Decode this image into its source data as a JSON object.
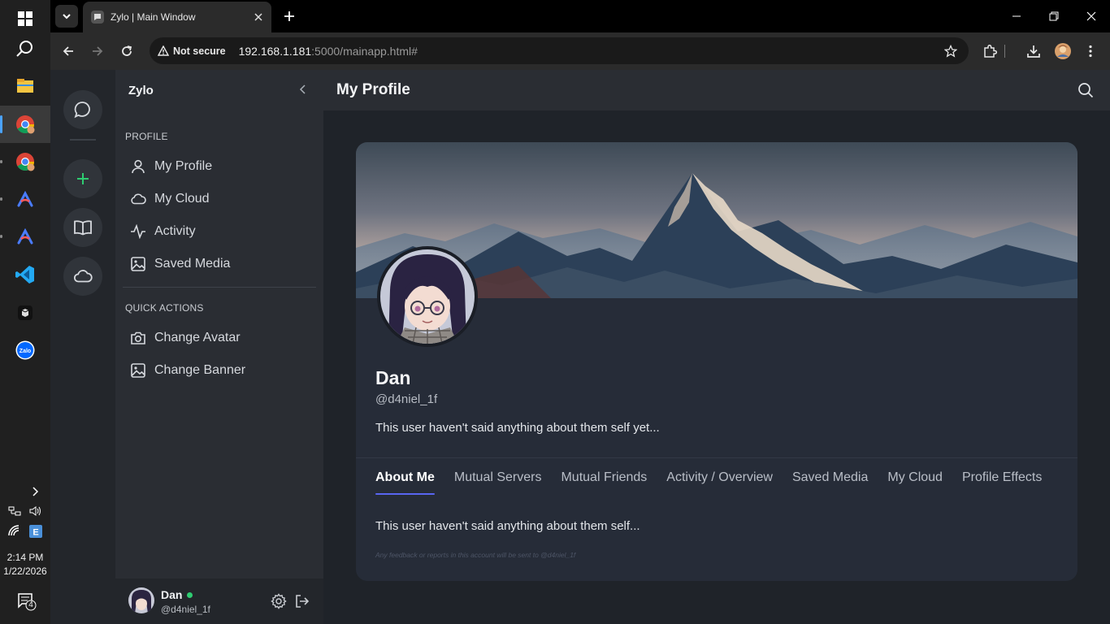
{
  "taskbar": {
    "time": "2:14 PM",
    "date": "1/22/2026",
    "notification_count": "4",
    "colors": {
      "accent": "#4aa3ff",
      "background": "#202020"
    }
  },
  "browser": {
    "tab_title": "Zylo | Main Window",
    "security_label": "Not secure",
    "url_host": "192.168.1.181",
    "url_rest": ":5000/mainapp.html#"
  },
  "app": {
    "sidebar": {
      "title": "Zylo",
      "profile_section": "PROFILE",
      "profile_items": [
        {
          "label": "My Profile",
          "icon": "user-icon"
        },
        {
          "label": "My Cloud",
          "icon": "cloud-icon"
        },
        {
          "label": "Activity",
          "icon": "activity-icon"
        },
        {
          "label": "Saved Media",
          "icon": "image-icon"
        }
      ],
      "quick_section": "QUICK ACTIONS",
      "quick_items": [
        {
          "label": "Change Avatar",
          "icon": "camera-icon"
        },
        {
          "label": "Change Banner",
          "icon": "image-icon"
        }
      ],
      "footer": {
        "name": "Dan",
        "handle": "@d4niel_1f",
        "status_color": "#2ecc71"
      }
    },
    "header": {
      "title": "My Profile"
    },
    "profile": {
      "name": "Dan",
      "handle": "@d4niel_1f",
      "bio": "This user haven't said anything about them self yet...",
      "tabs": [
        "About Me",
        "Mutual Servers",
        "Mutual Friends",
        "Activity / Overview",
        "Saved Media",
        "My Cloud",
        "Profile Effects"
      ],
      "active_tab": "About Me",
      "about_text": "This user haven't said anything about them self...",
      "fine_print": "Any feedback or reports in this account will be sent to @d4niel_1f",
      "colors": {
        "tab_accent": "#5865f2",
        "card_bg": "#262c38"
      }
    }
  }
}
